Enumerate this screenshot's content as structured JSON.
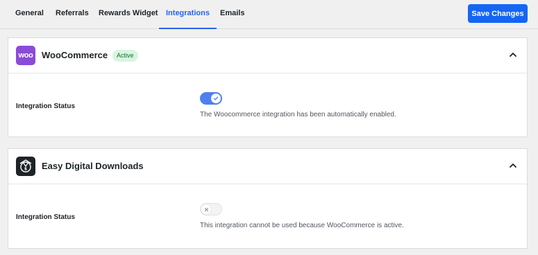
{
  "tabs": [
    {
      "label": "General",
      "active": false
    },
    {
      "label": "Referrals",
      "active": false
    },
    {
      "label": "Rewards Widget",
      "active": false
    },
    {
      "label": "Integrations",
      "active": true
    },
    {
      "label": "Emails",
      "active": false
    }
  ],
  "save_button": {
    "label": "Save Changes"
  },
  "colors": {
    "accent": "#1565f5",
    "active_tab": "#2563eb",
    "toggle_on": "#4f7ff1",
    "woo_logo": "#8c4ad8",
    "badge_bg": "#d7f5df"
  },
  "integrations": [
    {
      "logo_text": "woo",
      "logo_icon": "woocommerce-logo",
      "title": "WooCommerce",
      "badge": "Active",
      "status_label": "Integration Status",
      "toggle_enabled": true,
      "help_text": "The Woocommerce integration has been automatically enabled.",
      "collapse_icon": "chevron-up-icon"
    },
    {
      "logo_icon": "easy-digital-downloads-logo",
      "title": "Easy Digital Downloads",
      "status_label": "Integration Status",
      "toggle_enabled": false,
      "help_text": "This integration cannot be used because WooCommerce is active.",
      "collapse_icon": "chevron-up-icon"
    }
  ]
}
